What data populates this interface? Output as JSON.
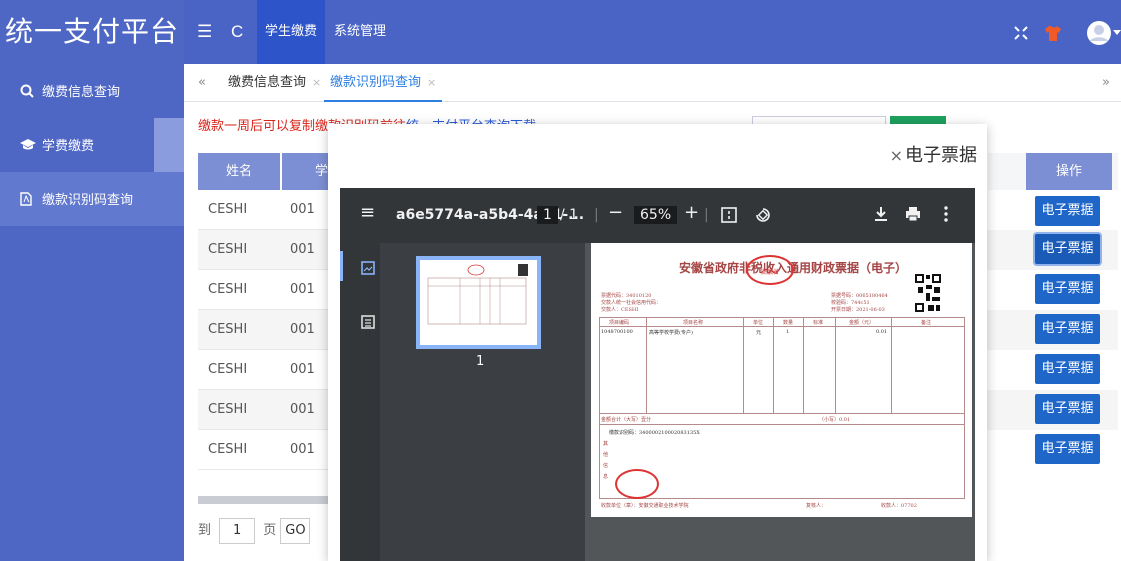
{
  "header": {
    "logo": "统一支付平台",
    "menu_icon": "☰",
    "refresh_icon": "C",
    "nav": [
      "学生缴费",
      "系统管理"
    ]
  },
  "sidebar": {
    "items": [
      {
        "icon": "search-icon",
        "label": "缴费信息查询"
      },
      {
        "icon": "graduation-cap-icon",
        "label": "学费缴费"
      },
      {
        "icon": "pdf-icon",
        "label": "缴款识别码查询"
      }
    ]
  },
  "tabs": {
    "back": "«",
    "forward": "»",
    "items": [
      {
        "label": "缴费信息查询",
        "close": "×"
      },
      {
        "label": "缴款识别码查询",
        "close": "×"
      }
    ]
  },
  "notice": {
    "text": "缴款一周后可以复制缴款识别码前往",
    "link": "统一支付平台查询下载"
  },
  "table": {
    "headers": [
      "姓名",
      "学",
      "操作"
    ],
    "rows": [
      {
        "name": "CESHI",
        "id": "001",
        "action": "电子票据"
      },
      {
        "name": "CESHI",
        "id": "001",
        "action": "电子票据"
      },
      {
        "name": "CESHI",
        "id": "001",
        "action": "电子票据"
      },
      {
        "name": "CESHI",
        "id": "001",
        "action": "电子票据"
      },
      {
        "name": "CESHI",
        "id": "001",
        "action": "电子票据"
      },
      {
        "name": "CESHI",
        "id": "001",
        "action": "电子票据"
      },
      {
        "name": "CESHI",
        "id": "001",
        "action": "电子票据"
      }
    ]
  },
  "pager": {
    "to": "到",
    "page_value": "1",
    "page": "页",
    "go": "GO"
  },
  "dialog": {
    "close": "×",
    "title": "电子票据"
  },
  "pdf_viewer": {
    "menu_icon": "≡",
    "filename": "a6e5774a-a5b4-4a61-...",
    "page_current": "1",
    "page_total": "/ 1",
    "zoom_out": "−",
    "zoom": "65%",
    "zoom_in": "+",
    "thumb_page": "1"
  },
  "invoice": {
    "title": "安徽省政府非税收入通用财政票据（电子）",
    "stamp_top": "安徽省",
    "fields_left": [
      "票据代码：34010120",
      "交款人统一社会信用代码：",
      "交款人：CESHI"
    ],
    "fields_right": [
      "票据号码：0065180464",
      "校验码：744c51",
      "开票日期：2021-06-03"
    ],
    "col_headers": [
      "项目编码",
      "项目名称",
      "单位",
      "数量",
      "标准",
      "金额（元）",
      "备注"
    ],
    "row": {
      "code": "1048700100",
      "name": "高等学校学费(专户)",
      "unit": "元",
      "qty": "1",
      "amount": "0.01"
    },
    "total_label": "金额合计（大写）壹分",
    "total_small": "（小写）0.01",
    "id_line": "缴款识别码：340000210002083135X",
    "side_label": "其他信息",
    "payee": "收款单位（章）：安徽交通职业技术学院",
    "reviewer": "复核人：",
    "payee_person": "收款人：07702"
  },
  "colors": {
    "primary": "#4a64c5",
    "accent": "#2d54c8",
    "button": "#1f66c9",
    "green": "#1ea160",
    "notice": "#d9261c"
  }
}
